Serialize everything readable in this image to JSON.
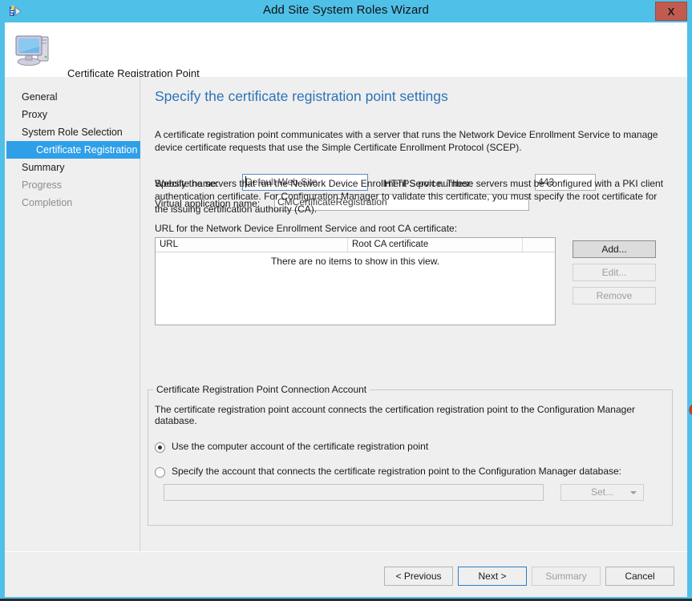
{
  "window": {
    "title": "Add Site System Roles Wizard",
    "close_label": "X",
    "titlebar_icon": "wizard-icon"
  },
  "banner": {
    "title": "Certificate Registration Point",
    "icon": "computer-icon"
  },
  "sidebar": {
    "items": [
      {
        "label": "General",
        "state": "normal",
        "sub": false
      },
      {
        "label": "Proxy",
        "state": "normal",
        "sub": false
      },
      {
        "label": "System Role Selection",
        "state": "normal",
        "sub": false
      },
      {
        "label": "Certificate Registration P",
        "state": "selected",
        "sub": true
      },
      {
        "label": "Summary",
        "state": "normal",
        "sub": false
      },
      {
        "label": "Progress",
        "state": "disabled",
        "sub": false
      },
      {
        "label": "Completion",
        "state": "disabled",
        "sub": false
      }
    ],
    "scroll": {
      "left_arrow": "‹",
      "right_arrow": "›",
      "thumb_grip": "III"
    }
  },
  "main": {
    "page_title": "Specify the certificate registration point settings",
    "intro_text": "A certificate registration point communicates with a server that runs the Network Device Enrollment Service to manage device certificate requests that use the Simple Certificate Enrollment Protocol (SCEP).",
    "website_name_label": "Website name:",
    "website_name_value": "Default Web Site",
    "https_port_label": "HTTPS port number:",
    "https_port_value": "443",
    "virtual_app_label": "Virtual application name:",
    "virtual_app_value": "CMCertificateRegistration",
    "servers_text": "Specify the servers that run the Network Device Enrollment Service.  These servers must be configured with a PKI client authentication certificate.  For Configuration Manager to validate this certificate, you must specify the root certificate for the issuing certification authority (CA).",
    "list_label": "URL for the Network Device Enrollment Service and root CA certificate:",
    "list": {
      "columns": [
        "URL",
        "Root CA certificate",
        ""
      ],
      "rows": [],
      "empty_message": "There are no items to show in this view."
    },
    "error_icon": "error-icon",
    "list_buttons": [
      {
        "label": "Add...",
        "enabled": true
      },
      {
        "label": "Edit...",
        "enabled": false
      },
      {
        "label": "Remove",
        "enabled": false
      }
    ],
    "group": {
      "title": "Certificate Registration Point Connection Account",
      "description": "The certificate registration point account connects the certification registration point to the Configuration Manager database.",
      "options": [
        {
          "label": "Use the computer account of the certificate registration point",
          "selected": true
        },
        {
          "label": "Specify the account that connects the certificate registration point to the Configuration Manager database:",
          "selected": false
        }
      ],
      "account_value": "",
      "set_button_label": "Set..."
    }
  },
  "footer": {
    "buttons": [
      {
        "label": "< Previous",
        "enabled": true,
        "default": false
      },
      {
        "label": "Next >",
        "enabled": true,
        "default": true
      },
      {
        "label": "Summary",
        "enabled": false,
        "default": false
      },
      {
        "label": "Cancel",
        "enabled": true,
        "default": false
      }
    ]
  }
}
